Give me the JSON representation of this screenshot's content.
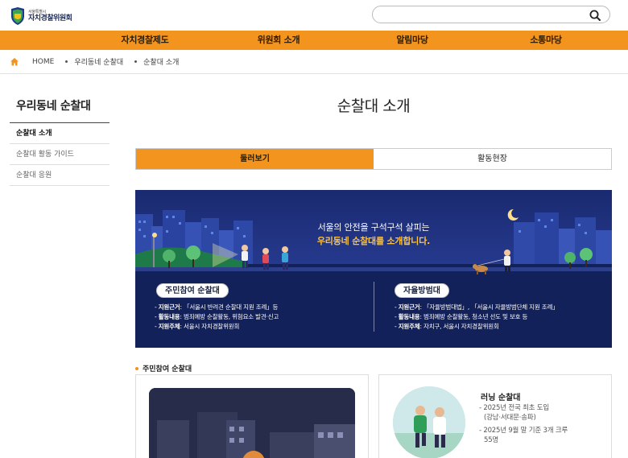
{
  "header": {
    "logo_small": "서울특별시",
    "logo_big": "자치경찰위원회",
    "search_placeholder": ""
  },
  "gnb": [
    "자치경찰제도",
    "위원회 소개",
    "알림마당",
    "소통마당"
  ],
  "breadcrumb": {
    "home": "HOME",
    "level1": "우리동네 순찰대",
    "level2": "순찰대 소개"
  },
  "sidebar": {
    "title": "우리동네 순찰대",
    "items": [
      {
        "label": "순찰대 소개",
        "active": true
      },
      {
        "label": "순찰대 활동 가이드",
        "active": false
      },
      {
        "label": "순찰대 응원",
        "active": false
      }
    ]
  },
  "main": {
    "title": "순찰대 소개",
    "tabs": [
      {
        "label": "둘러보기",
        "active": true
      },
      {
        "label": "활동현장",
        "active": false
      }
    ]
  },
  "banner": {
    "line1": "서울의 안전을 구석구석 살피는",
    "line2": "우리동네 순찰대를 소개합니다.",
    "left": {
      "pill": "주민참여 순찰대",
      "rows": [
        {
          "key": "지원근거",
          "value": ": 「서울시 반려견 순찰대 지원 조례」등"
        },
        {
          "key": "활동내용",
          "value": ": 범죄예방 순찰활동, 위험요소 발견·신고"
        },
        {
          "key": "지원주체",
          "value": ": 서울시 자치경찰위원회"
        }
      ]
    },
    "right": {
      "pill": "자율방범대",
      "rows": [
        {
          "key": "지원근거",
          "value": ": 「자율방범대법」, 「서울시 자율방범단체 지원 조례」"
        },
        {
          "key": "활동내용",
          "value": ": 범죄예방 순찰활동, 청소년 선도 및 보호 등"
        },
        {
          "key": "지원주체",
          "value": ": 자치구, 서울시 자치경찰위원회"
        }
      ]
    }
  },
  "section": {
    "title": "주민참여 순찰대",
    "card_right": {
      "title": "러닝 순찰대",
      "line1": "- 2025년 전국 최초 도입",
      "line2": "(강남·서대문·송파)",
      "line3": "- 2025년 9월 말 기준 3개 크루",
      "line4": "55명"
    }
  },
  "colors": {
    "accent": "#f2941d",
    "banner_bg": "#122257",
    "banner_highlight": "#ffc23a"
  }
}
